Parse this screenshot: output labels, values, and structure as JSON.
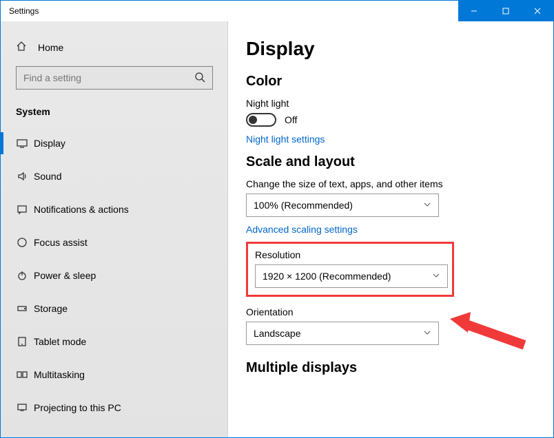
{
  "window": {
    "title": "Settings"
  },
  "sidebar": {
    "home_label": "Home",
    "search_placeholder": "Find a setting",
    "section_label": "System",
    "items": [
      {
        "label": "Display"
      },
      {
        "label": "Sound"
      },
      {
        "label": "Notifications & actions"
      },
      {
        "label": "Focus assist"
      },
      {
        "label": "Power & sleep"
      },
      {
        "label": "Storage"
      },
      {
        "label": "Tablet mode"
      },
      {
        "label": "Multitasking"
      },
      {
        "label": "Projecting to this PC"
      }
    ]
  },
  "main": {
    "page_title": "Display",
    "color_heading": "Color",
    "night_light_label": "Night light",
    "night_light_state": "Off",
    "night_light_link": "Night light settings",
    "scale_heading": "Scale and layout",
    "scale_label": "Change the size of text, apps, and other items",
    "scale_value": "100% (Recommended)",
    "adv_scaling_link": "Advanced scaling settings",
    "resolution_label": "Resolution",
    "resolution_value": "1920 × 1200 (Recommended)",
    "orientation_label": "Orientation",
    "orientation_value": "Landscape",
    "multiple_heading": "Multiple displays"
  }
}
